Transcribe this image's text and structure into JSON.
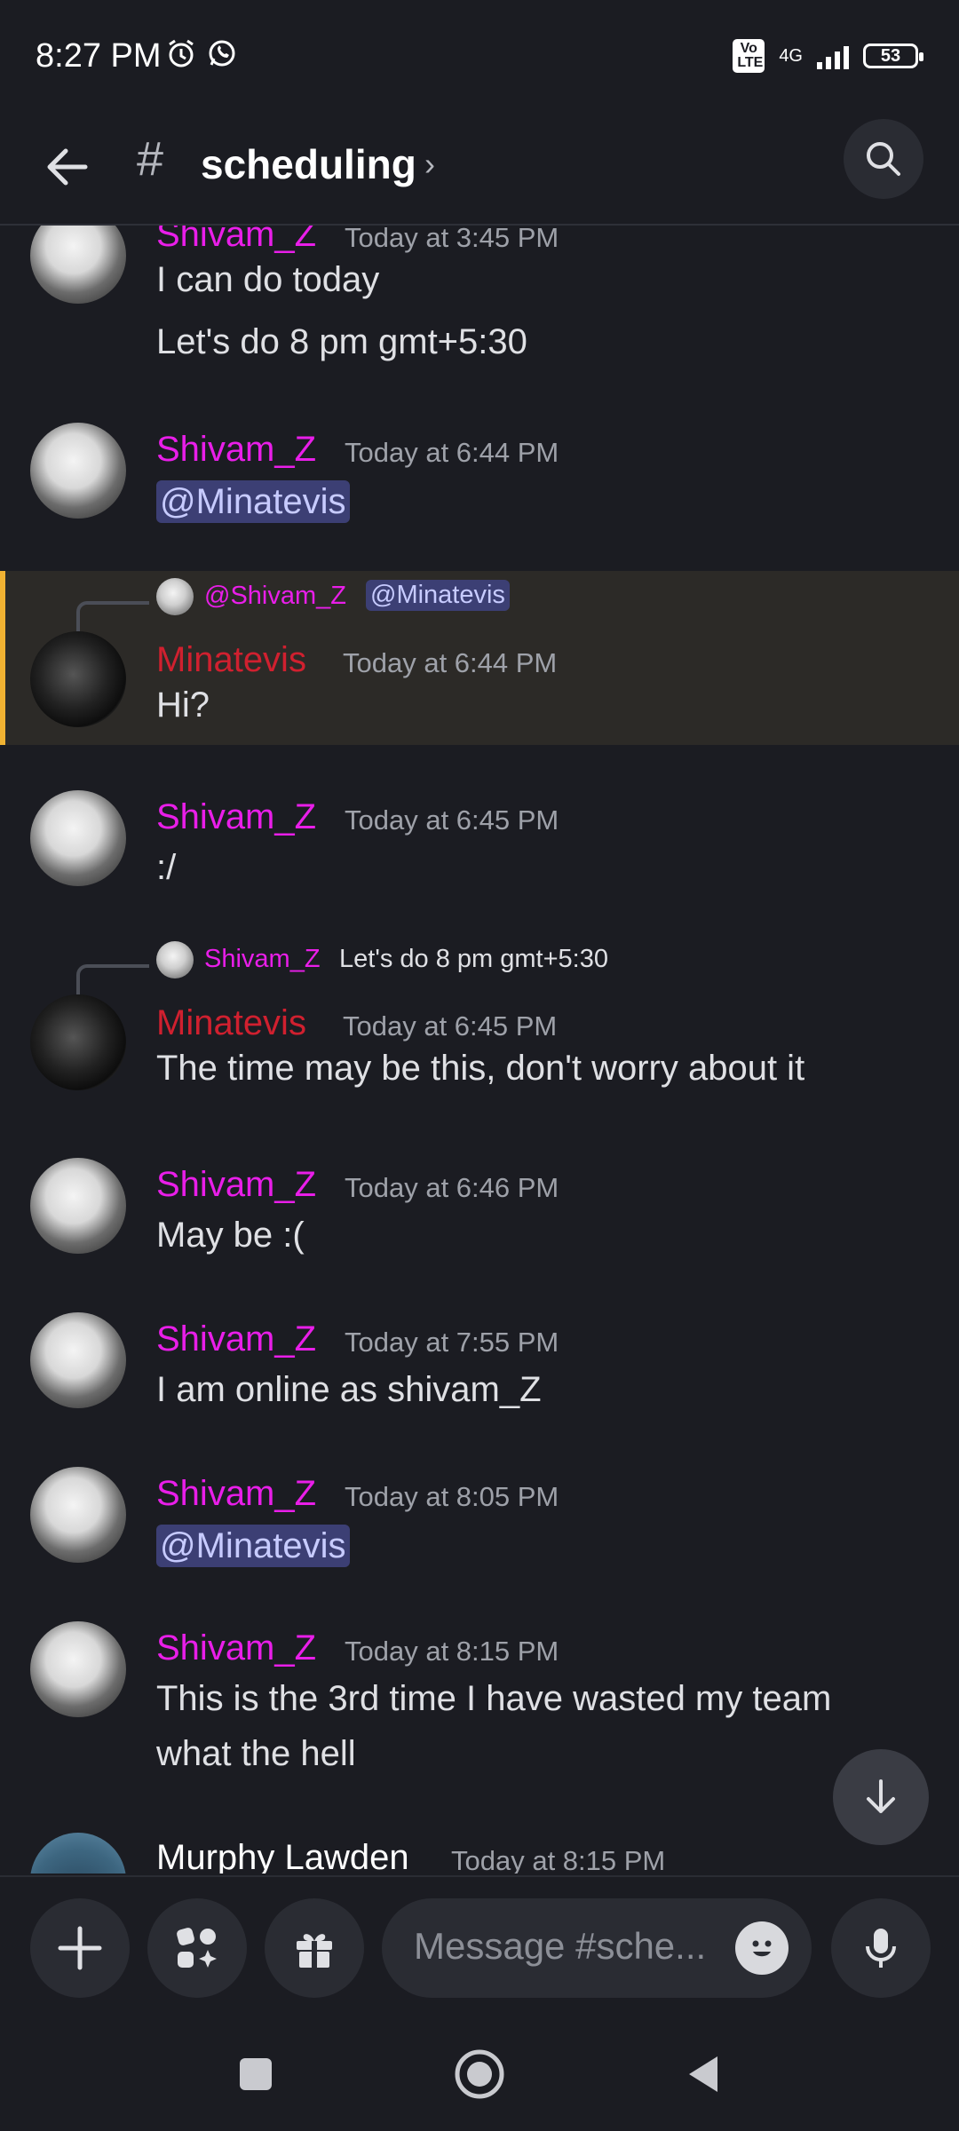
{
  "status": {
    "time": "8:27 PM",
    "volte": "Vo LTE",
    "network": "4G",
    "battery": "53"
  },
  "header": {
    "hash": "#",
    "channel": "scheduling",
    "chevron": "›"
  },
  "messages": [
    {
      "user": "Shivam_Z",
      "time": "Today at 3:45 PM",
      "lines": [
        "I can do today",
        "Let's do 8 pm gmt+5:30"
      ]
    },
    {
      "user": "Shivam_Z",
      "time": "Today at 6:44 PM",
      "mention": "@Minatevis"
    },
    {
      "user": "Minatevis",
      "time": "Today at 6:44 PM",
      "text": "Hi?",
      "reply": {
        "name": "@Shivam_Z",
        "mention": "@Minatevis"
      }
    },
    {
      "user": "Shivam_Z",
      "time": "Today at 6:45 PM",
      "text": ":/"
    },
    {
      "user": "Minatevis",
      "time": "Today at 6:45 PM",
      "text": "The time may be this, don't worry about it",
      "reply": {
        "name": "Shivam_Z",
        "text": "Let's do 8 pm gmt+5:30"
      }
    },
    {
      "user": "Shivam_Z",
      "time": "Today at 6:46 PM",
      "text": "May be :("
    },
    {
      "user": "Shivam_Z",
      "time": "Today at 7:55 PM",
      "text": "I am online as shivam_Z"
    },
    {
      "user": "Shivam_Z",
      "time": "Today at 8:05 PM",
      "mention": "@Minatevis"
    },
    {
      "user": "Shivam_Z",
      "time": "Today at 8:15 PM",
      "lines": [
        "This is the 3rd time I have wasted my team",
        "what the hell"
      ]
    },
    {
      "user": "Murphy Lawden",
      "time": "Today at 8:15 PM"
    }
  ],
  "composer": {
    "placeholder": "Message #sche..."
  },
  "colors": {
    "background": "#1b1c22",
    "shivam": "#e91ee9",
    "minatevis": "#d0202f",
    "highlight": "#f0b232",
    "mention_bg": "#3c3f74"
  }
}
